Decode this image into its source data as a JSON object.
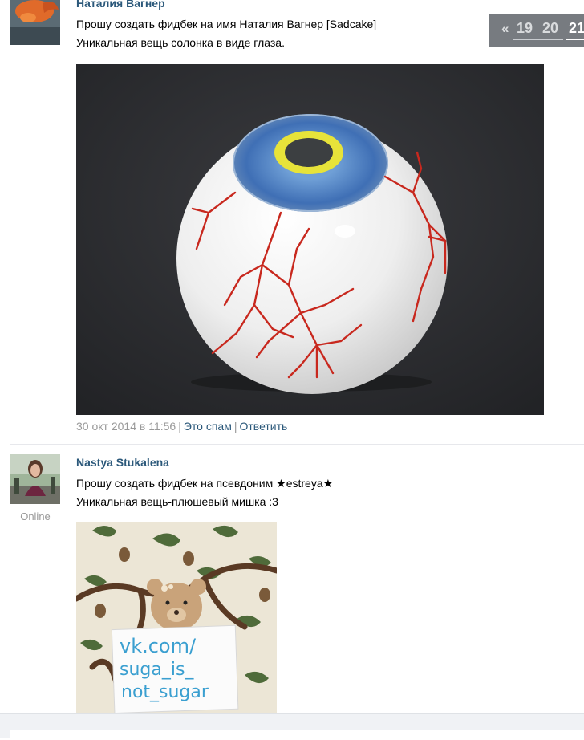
{
  "posts": [
    {
      "author": "Наталия Вагнер",
      "lines": [
        "Прошу создать фидбек на имя Наталия Вагнер [Sadcake]",
        "Уникальная вещь солонка в виде глаза."
      ],
      "date": "30 окт 2014 в 11:56",
      "spam_label": "Это спам",
      "reply_label": "Ответить"
    },
    {
      "author": "Nastya Stukalena",
      "lines": [
        "Прошу создать фидбек на псевдоним ★estreya★",
        "Уникальная вещь-плюшевый мишка :3"
      ],
      "status": "Online",
      "sign_text": [
        "vk.com/",
        "suga_is_",
        "not_sugar"
      ]
    }
  ],
  "pager": {
    "prev": "«",
    "pages": [
      "19",
      "20",
      "21"
    ],
    "current": "21"
  }
}
